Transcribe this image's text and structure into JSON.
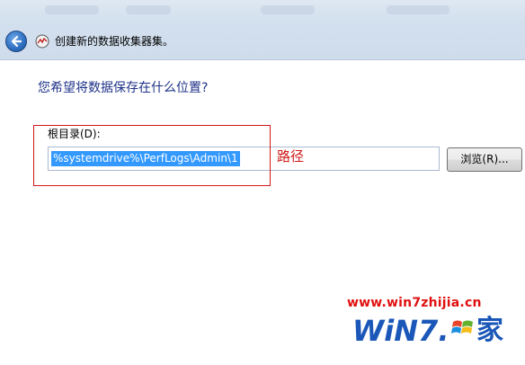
{
  "window": {
    "title": "创建新的数据收集器集。"
  },
  "page": {
    "question": "您希望将数据保存在什么位置?"
  },
  "root_directory": {
    "label": "根目录(D):",
    "value": "%systemdrive%\\PerfLogs\\Admin\\1"
  },
  "browse_button": {
    "label": "浏览(R)..."
  },
  "annotation": {
    "path_label": "路径",
    "color": "#d01818"
  },
  "watermark": {
    "url": "www.win7zhijia.cn",
    "logo_text": "WiN7.",
    "logo_suffix": "家"
  },
  "icons": {
    "back": "back-arrow-icon",
    "wizard": "performance-monitor-icon"
  }
}
